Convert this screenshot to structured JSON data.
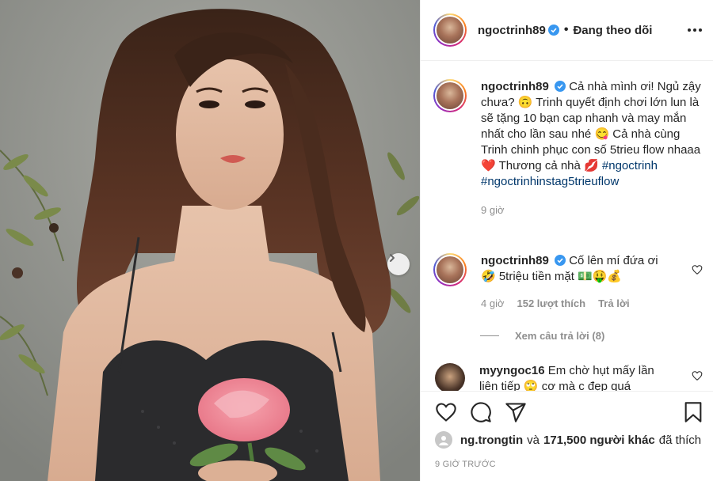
{
  "header": {
    "username": "ngoctrinh89",
    "separator": "•",
    "follow_status": "Đang theo dõi"
  },
  "caption": {
    "username": "ngoctrinh89",
    "text": "Cả nhà mình ơi! Ngủ zậy chưa? 🙃 Trinh quyết định chơi lớn lun là sẽ tặng 10 bạn cap nhanh và may mắn nhất cho lần sau nhé 😋 Cả nhà cùng Trinh chinh phục con số 5trieu flow nhaaa",
    "text_after_heart": "Thương cả nhà",
    "hashtag_1": "#ngoctrinh",
    "hashtag_2": "#ngoctrinhinstag5trieuflow",
    "time": "9 giờ",
    "heart_emoji": "❤️",
    "lips_emoji": "💋"
  },
  "comment_1": {
    "username": "ngoctrinh89",
    "text": "Cố lên mí đứa ơi",
    "text_line2": "🤣 5triệu tiền mặt 💵🤑💰",
    "time": "4 giờ",
    "likes": "152 lượt thích",
    "reply": "Trả lời",
    "view_replies": "Xem câu trả lời (8)"
  },
  "comment_2": {
    "username": "myyngoc16",
    "text": "Em chờ hụt mấy lần",
    "text_line2": "liên tiếp 🙄 cơ mà c đẹp quá"
  },
  "likes": {
    "first_user": "ng.trongtin",
    "connector": "và",
    "others": "171,500 người khác",
    "suffix": "đã thích"
  },
  "timestamp": "9 GIỜ TRƯỚC",
  "icons": [
    "verified-badge-icon",
    "more-options-icon",
    "heart-icon",
    "comment-icon",
    "share-icon",
    "bookmark-icon",
    "chevron-right-icon"
  ],
  "colors": {
    "accent_link": "#00376b",
    "verified": "#3897f0",
    "muted": "#8e8e8e"
  }
}
